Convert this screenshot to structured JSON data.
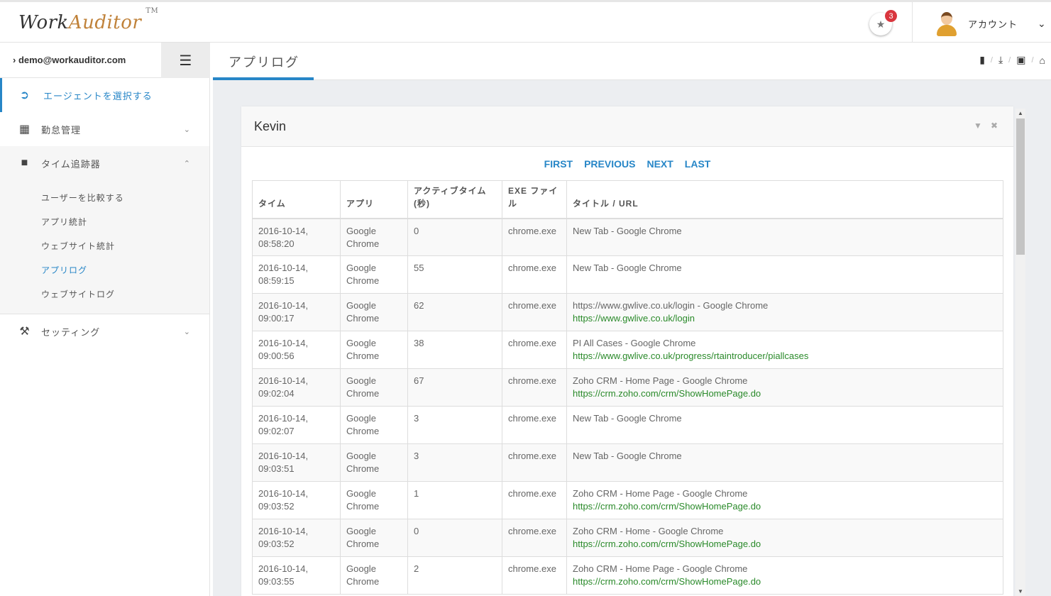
{
  "header": {
    "logo_part1": "Work",
    "logo_part2": "Auditor",
    "logo_tm": "TM",
    "notification_count": "3",
    "account_label": "アカウント"
  },
  "sidebar": {
    "email": "demo@workauditor.com",
    "menu": [
      {
        "label": "エージェントを選択する",
        "icon": "sign-in-icon"
      },
      {
        "label": "勤怠管理",
        "icon": "calendar-icon"
      },
      {
        "label": "タイム追跡器",
        "icon": "file-icon"
      },
      {
        "label": "セッティング",
        "icon": "wrench-icon"
      }
    ],
    "submenu": [
      "ユーザーを比較する",
      "アプリ統計",
      "ウェブサイト統計",
      "アプリログ",
      "ウェブサイトログ"
    ]
  },
  "page": {
    "title": "アプリログ"
  },
  "portlet": {
    "title": "Kevin",
    "pager": {
      "first": "FIRST",
      "previous": "PREVIOUS",
      "next": "NEXT",
      "last": "LAST"
    }
  },
  "table": {
    "headers": [
      "タイム",
      "アプリ",
      "アクティブタイム (秒)",
      "EXE ファイル",
      "タイトル / URL"
    ],
    "rows": [
      {
        "time": "2016-10-14, 08:58:20",
        "app": "Google Chrome",
        "active": "0",
        "exe": "chrome.exe",
        "title": "New Tab - Google Chrome",
        "url": ""
      },
      {
        "time": "2016-10-14, 08:59:15",
        "app": "Google Chrome",
        "active": "55",
        "exe": "chrome.exe",
        "title": "New Tab - Google Chrome",
        "url": ""
      },
      {
        "time": "2016-10-14, 09:00:17",
        "app": "Google Chrome",
        "active": "62",
        "exe": "chrome.exe",
        "title": "https://www.gwlive.co.uk/login - Google Chrome",
        "url": "https://www.gwlive.co.uk/login"
      },
      {
        "time": "2016-10-14, 09:00:56",
        "app": "Google Chrome",
        "active": "38",
        "exe": "chrome.exe",
        "title": "PI All Cases - Google Chrome",
        "url": "https://www.gwlive.co.uk/progress/rtaintroducer/piallcases"
      },
      {
        "time": "2016-10-14, 09:02:04",
        "app": "Google Chrome",
        "active": "67",
        "exe": "chrome.exe",
        "title": "Zoho CRM - Home Page - Google Chrome",
        "url": "https://crm.zoho.com/crm/ShowHomePage.do"
      },
      {
        "time": "2016-10-14, 09:02:07",
        "app": "Google Chrome",
        "active": "3",
        "exe": "chrome.exe",
        "title": "New Tab - Google Chrome",
        "url": ""
      },
      {
        "time": "2016-10-14, 09:03:51",
        "app": "Google Chrome",
        "active": "3",
        "exe": "chrome.exe",
        "title": "New Tab - Google Chrome",
        "url": ""
      },
      {
        "time": "2016-10-14, 09:03:52",
        "app": "Google Chrome",
        "active": "1",
        "exe": "chrome.exe",
        "title": "Zoho CRM - Home Page - Google Chrome",
        "url": "https://crm.zoho.com/crm/ShowHomePage.do"
      },
      {
        "time": "2016-10-14, 09:03:52",
        "app": "Google Chrome",
        "active": "0",
        "exe": "chrome.exe",
        "title": "Zoho CRM - Home - Google Chrome",
        "url": "https://crm.zoho.com/crm/ShowHomePage.do"
      },
      {
        "time": "2016-10-14, 09:03:55",
        "app": "Google Chrome",
        "active": "2",
        "exe": "chrome.exe",
        "title": "Zoho CRM - Home Page - Google Chrome",
        "url": "https://crm.zoho.com/crm/ShowHomePage.do"
      }
    ]
  },
  "colors": {
    "accent": "#2786c7",
    "url_green": "#2a8a2a",
    "badge_red": "#d9363e"
  }
}
